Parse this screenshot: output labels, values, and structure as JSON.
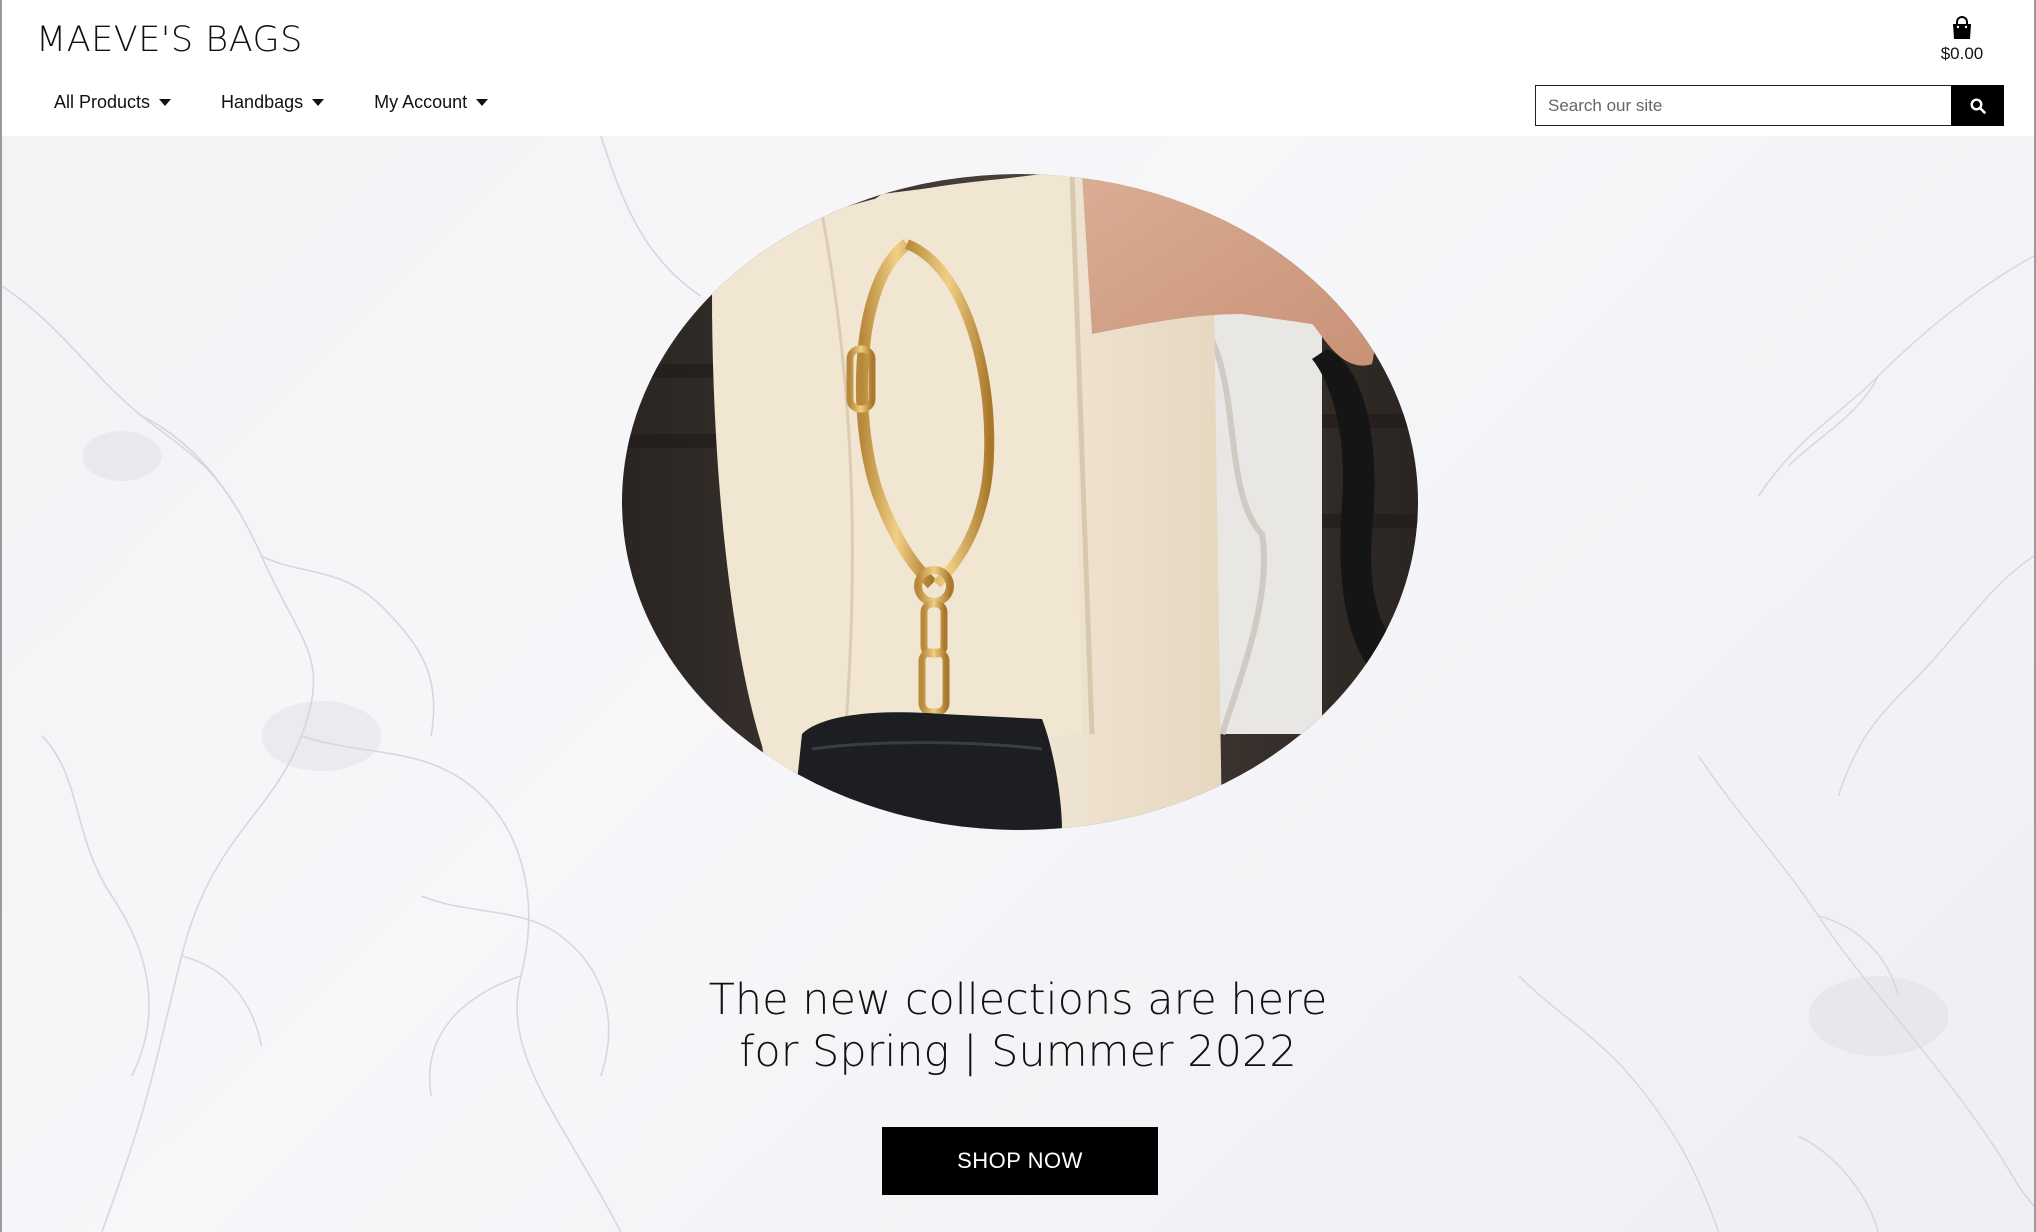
{
  "header": {
    "brand": "MAEVE'S BAGS",
    "cart_total": "$0.00",
    "cart_icon": "shopping-bag-icon",
    "nav": [
      {
        "label": "All Products"
      },
      {
        "label": "Handbags"
      },
      {
        "label": "My Account"
      }
    ],
    "search": {
      "placeholder": "Search our site",
      "value": "",
      "icon": "search-icon"
    }
  },
  "hero": {
    "image": "woman-holding-black-handbag-with-gold-ring-handle",
    "headline_line1": "The new collections are here",
    "headline_line2": "for Spring | Summer 2022",
    "cta_label": "SHOP NOW"
  },
  "colors": {
    "accent": "#000000",
    "background": "#f5f5f8"
  }
}
